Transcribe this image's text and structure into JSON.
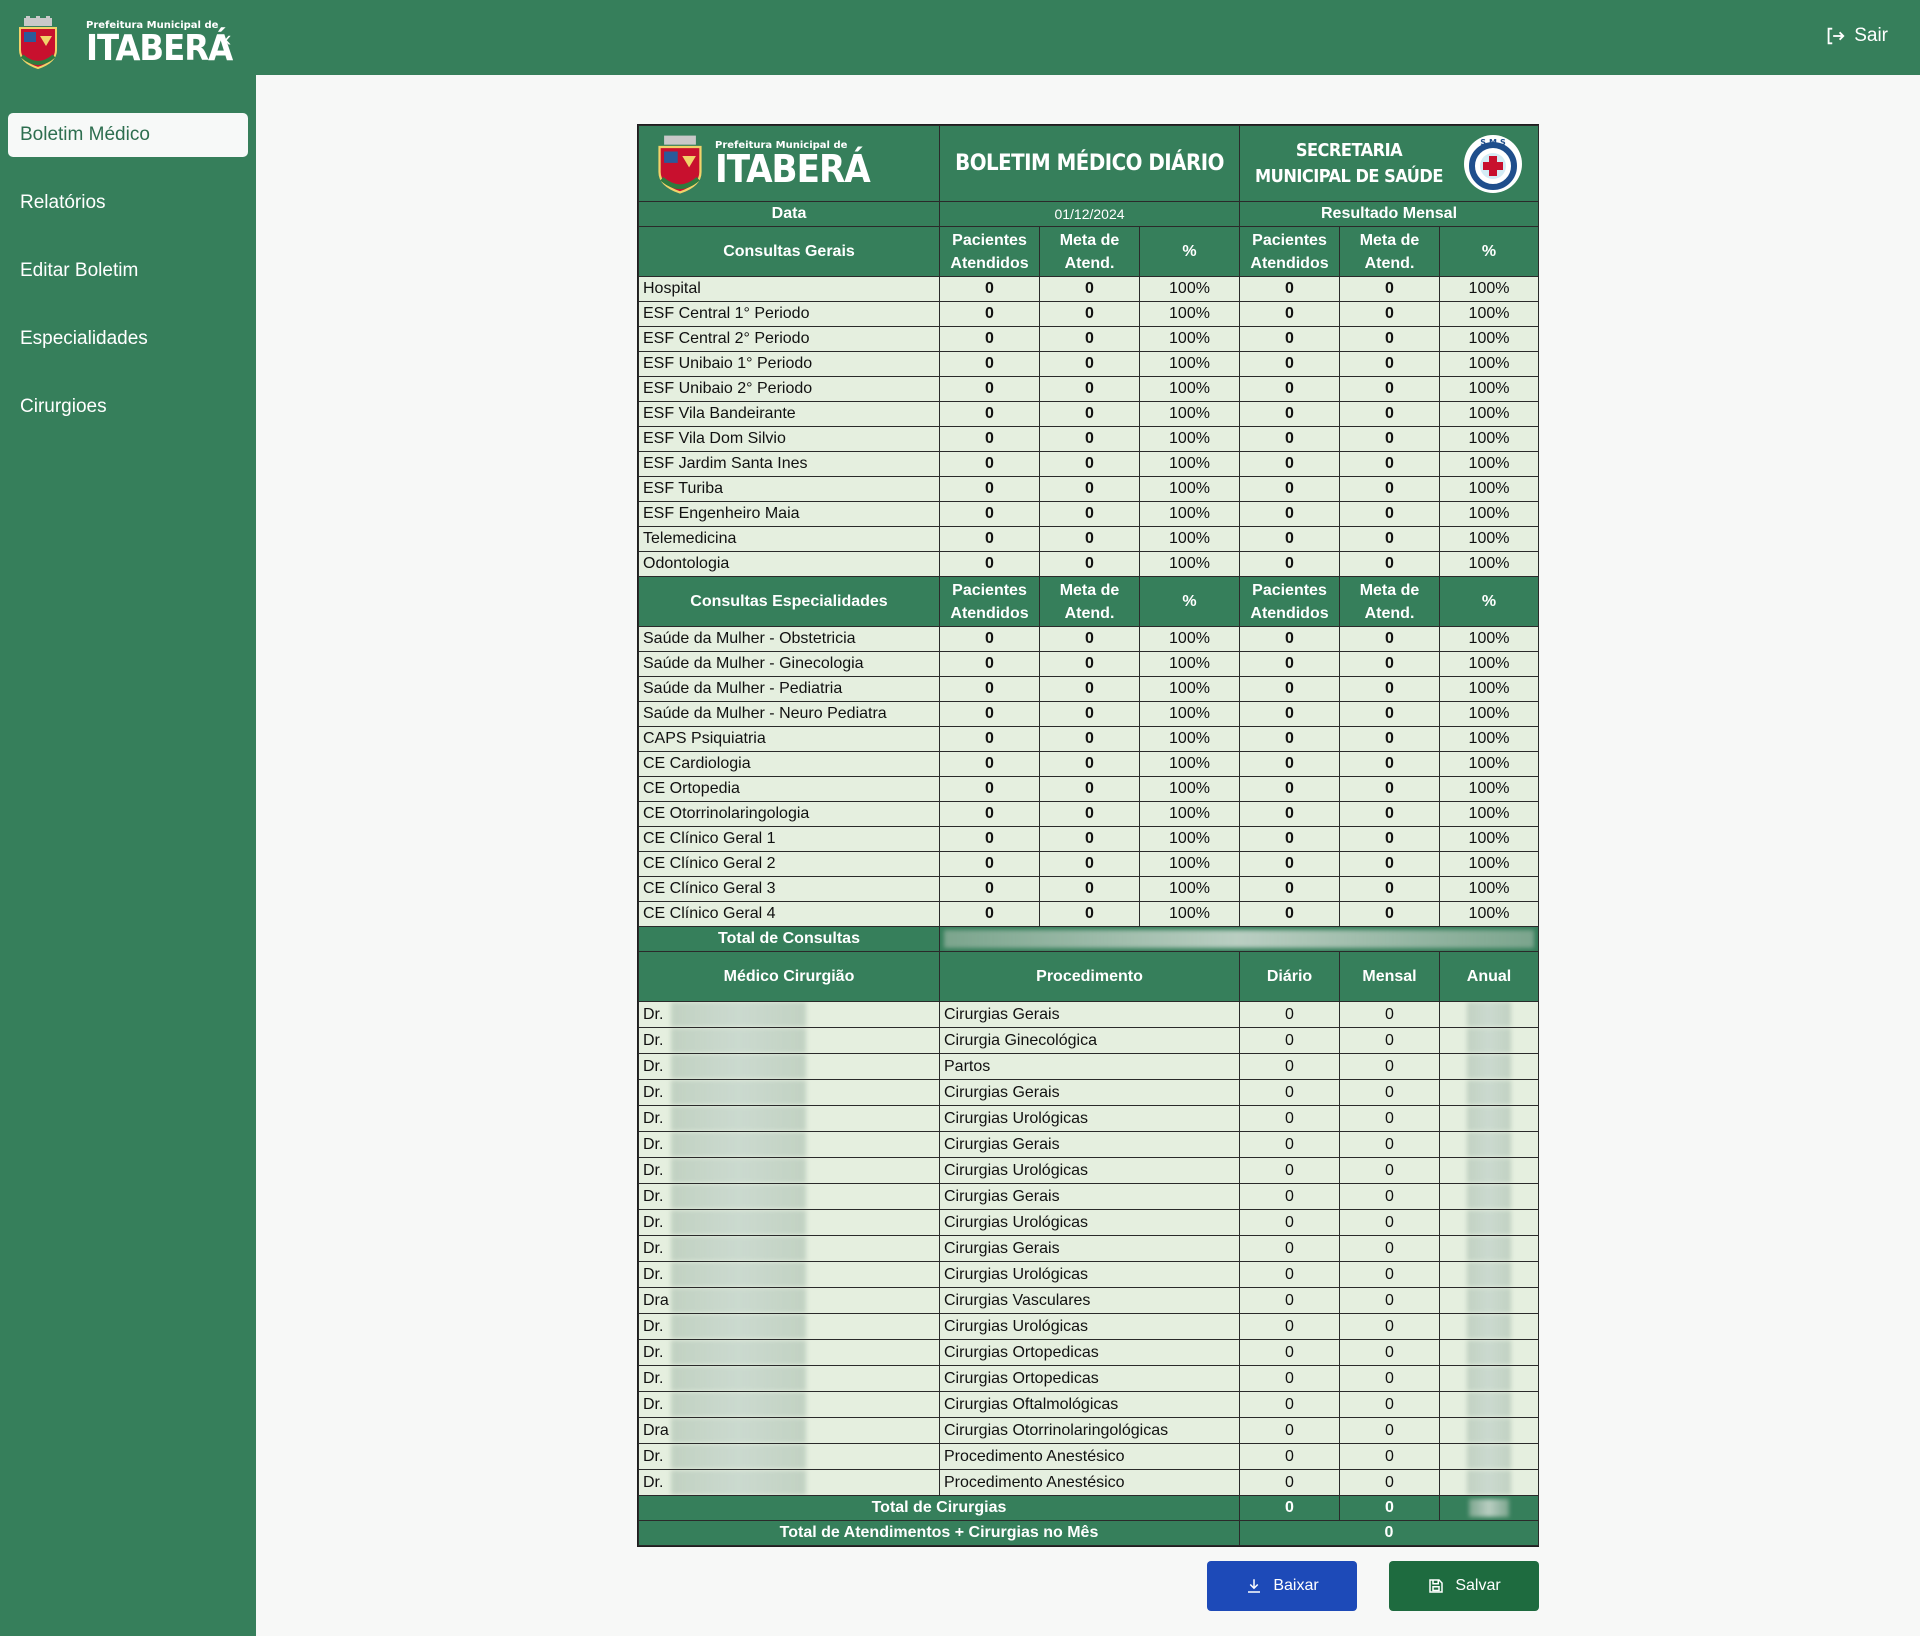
{
  "header": {
    "brand_prefix": "Prefeitura Municipal de",
    "brand_name": "ITABERÁ",
    "logout_label": "Sair"
  },
  "sidebar": {
    "items": [
      {
        "label": "Boletim Médico"
      },
      {
        "label": "Relatórios"
      },
      {
        "label": "Editar Boletim"
      },
      {
        "label": "Especialidades"
      },
      {
        "label": "Cirurgioes"
      }
    ]
  },
  "report": {
    "logo_prefix": "Prefeitura Municipal de",
    "logo_name": "ITABERÁ",
    "title": "BOLETIM MÉDICO DIÁRIO",
    "secretaria_line1": "SECRETARIA",
    "secretaria_line2": "MUNICIPAL DE SAÚDE",
    "sms_badge": "S.M.S",
    "data_label": "Data",
    "date": "01/12/2024",
    "monthly_label": "Resultado Mensal",
    "col_pacientes_1": "Pacientes",
    "col_pacientes_2": "Atendidos",
    "col_meta_1": "Meta de",
    "col_meta_2": "Atend.",
    "col_pct": "%",
    "general_label": "Consultas Gerais",
    "general_rows": [
      {
        "name": "Hospital",
        "pa": "0",
        "meta": "0",
        "pct": "100%",
        "mpa": "0",
        "mmeta": "0",
        "mpct": "100%"
      },
      {
        "name": "ESF Central 1° Periodo",
        "pa": "0",
        "meta": "0",
        "pct": "100%",
        "mpa": "0",
        "mmeta": "0",
        "mpct": "100%"
      },
      {
        "name": "ESF Central 2° Periodo",
        "pa": "0",
        "meta": "0",
        "pct": "100%",
        "mpa": "0",
        "mmeta": "0",
        "mpct": "100%"
      },
      {
        "name": "ESF Unibaio 1° Periodo",
        "pa": "0",
        "meta": "0",
        "pct": "100%",
        "mpa": "0",
        "mmeta": "0",
        "mpct": "100%"
      },
      {
        "name": "ESF Unibaio 2° Periodo",
        "pa": "0",
        "meta": "0",
        "pct": "100%",
        "mpa": "0",
        "mmeta": "0",
        "mpct": "100%"
      },
      {
        "name": "ESF Vila Bandeirante",
        "pa": "0",
        "meta": "0",
        "pct": "100%",
        "mpa": "0",
        "mmeta": "0",
        "mpct": "100%"
      },
      {
        "name": "ESF Vila Dom Silvio",
        "pa": "0",
        "meta": "0",
        "pct": "100%",
        "mpa": "0",
        "mmeta": "0",
        "mpct": "100%"
      },
      {
        "name": "ESF Jardim Santa Ines",
        "pa": "0",
        "meta": "0",
        "pct": "100%",
        "mpa": "0",
        "mmeta": "0",
        "mpct": "100%"
      },
      {
        "name": "ESF Turiba",
        "pa": "0",
        "meta": "0",
        "pct": "100%",
        "mpa": "0",
        "mmeta": "0",
        "mpct": "100%"
      },
      {
        "name": "ESF Engenheiro Maia",
        "pa": "0",
        "meta": "0",
        "pct": "100%",
        "mpa": "0",
        "mmeta": "0",
        "mpct": "100%"
      },
      {
        "name": "Telemedicina",
        "pa": "0",
        "meta": "0",
        "pct": "100%",
        "mpa": "0",
        "mmeta": "0",
        "mpct": "100%"
      },
      {
        "name": "Odontologia",
        "pa": "0",
        "meta": "0",
        "pct": "100%",
        "mpa": "0",
        "mmeta": "0",
        "mpct": "100%"
      }
    ],
    "special_label": "Consultas Especialidades",
    "special_rows": [
      {
        "name": "Saúde da Mulher - Obstetricia",
        "pa": "0",
        "meta": "0",
        "pct": "100%",
        "mpa": "0",
        "mmeta": "0",
        "mpct": "100%"
      },
      {
        "name": "Saúde da Mulher - Ginecologia",
        "pa": "0",
        "meta": "0",
        "pct": "100%",
        "mpa": "0",
        "mmeta": "0",
        "mpct": "100%"
      },
      {
        "name": "Saúde da Mulher - Pediatria",
        "pa": "0",
        "meta": "0",
        "pct": "100%",
        "mpa": "0",
        "mmeta": "0",
        "mpct": "100%"
      },
      {
        "name": "Saúde da Mulher - Neuro Pediatra",
        "pa": "0",
        "meta": "0",
        "pct": "100%",
        "mpa": "0",
        "mmeta": "0",
        "mpct": "100%"
      },
      {
        "name": "CAPS Psiquiatria",
        "pa": "0",
        "meta": "0",
        "pct": "100%",
        "mpa": "0",
        "mmeta": "0",
        "mpct": "100%"
      },
      {
        "name": "CE Cardiologia",
        "pa": "0",
        "meta": "0",
        "pct": "100%",
        "mpa": "0",
        "mmeta": "0",
        "mpct": "100%"
      },
      {
        "name": "CE Ortopedia",
        "pa": "0",
        "meta": "0",
        "pct": "100%",
        "mpa": "0",
        "mmeta": "0",
        "mpct": "100%"
      },
      {
        "name": "CE Otorrinolaringologia",
        "pa": "0",
        "meta": "0",
        "pct": "100%",
        "mpa": "0",
        "mmeta": "0",
        "mpct": "100%"
      },
      {
        "name": "CE Clínico Geral 1",
        "pa": "0",
        "meta": "0",
        "pct": "100%",
        "mpa": "0",
        "mmeta": "0",
        "mpct": "100%"
      },
      {
        "name": "CE Clínico Geral 2",
        "pa": "0",
        "meta": "0",
        "pct": "100%",
        "mpa": "0",
        "mmeta": "0",
        "mpct": "100%"
      },
      {
        "name": "CE Clínico Geral 3",
        "pa": "0",
        "meta": "0",
        "pct": "100%",
        "mpa": "0",
        "mmeta": "0",
        "mpct": "100%"
      },
      {
        "name": "CE Clínico Geral 4",
        "pa": "0",
        "meta": "0",
        "pct": "100%",
        "mpa": "0",
        "mmeta": "0",
        "mpct": "100%"
      }
    ],
    "total_consultas_label": "Total de Consultas",
    "surgery_headers": {
      "doctor": "Médico Cirurgião",
      "procedure": "Procedimento",
      "daily": "Diário",
      "monthly": "Mensal",
      "annual": "Anual"
    },
    "surgery_rows": [
      {
        "doctor": "Dr.",
        "procedure": "Cirurgias Gerais",
        "daily": "0",
        "monthly": "0"
      },
      {
        "doctor": "Dr.",
        "procedure": "Cirurgia Ginecológica",
        "daily": "0",
        "monthly": "0"
      },
      {
        "doctor": "Dr.",
        "procedure": "Partos",
        "daily": "0",
        "monthly": "0"
      },
      {
        "doctor": "Dr.",
        "procedure": "Cirurgias Gerais",
        "daily": "0",
        "monthly": "0"
      },
      {
        "doctor": "Dr.",
        "procedure": "Cirurgias Urológicas",
        "daily": "0",
        "monthly": "0"
      },
      {
        "doctor": "Dr.",
        "procedure": "Cirurgias Gerais",
        "daily": "0",
        "monthly": "0"
      },
      {
        "doctor": "Dr.",
        "procedure": "Cirurgias Urológicas",
        "daily": "0",
        "monthly": "0"
      },
      {
        "doctor": "Dr.",
        "procedure": "Cirurgias Gerais",
        "daily": "0",
        "monthly": "0"
      },
      {
        "doctor": "Dr.",
        "procedure": "Cirurgias Urológicas",
        "daily": "0",
        "monthly": "0"
      },
      {
        "doctor": "Dr.",
        "procedure": "Cirurgias Gerais",
        "daily": "0",
        "monthly": "0"
      },
      {
        "doctor": "Dr.",
        "procedure": "Cirurgias Urológicas",
        "daily": "0",
        "monthly": "0"
      },
      {
        "doctor": "Dra",
        "procedure": "Cirurgias Vasculares",
        "daily": "0",
        "monthly": "0"
      },
      {
        "doctor": "Dr.",
        "procedure": "Cirurgias Urológicas",
        "daily": "0",
        "monthly": "0"
      },
      {
        "doctor": "Dr.",
        "procedure": "Cirurgias Ortopedicas",
        "daily": "0",
        "monthly": "0"
      },
      {
        "doctor": "Dr.",
        "procedure": "Cirurgias Ortopedicas",
        "daily": "0",
        "monthly": "0"
      },
      {
        "doctor": "Dr.",
        "procedure": "Cirurgias Oftalmológicas",
        "daily": "0",
        "monthly": "0"
      },
      {
        "doctor": "Dra",
        "procedure": "Cirurgias Otorrinolaringológicas",
        "daily": "0",
        "monthly": "0"
      },
      {
        "doctor": "Dr.",
        "procedure": "Procedimento Anestésico",
        "daily": "0",
        "monthly": "0"
      },
      {
        "doctor": "Dr.",
        "procedure": "Procedimento Anestésico",
        "daily": "0",
        "monthly": "0"
      }
    ],
    "total_cirurgias_label": "Total de Cirurgias",
    "total_cirurgias_daily": "0",
    "total_cirurgias_monthly": "0",
    "grand_total_label": "Total de Atendimentos + Cirurgias no Mês",
    "grand_total_value": "0"
  },
  "actions": {
    "download_label": "Baixar",
    "save_label": "Salvar"
  },
  "colors": {
    "brand_green": "#367f5b",
    "row_bg": "#e5efdf",
    "download_blue": "#1d4ab8",
    "save_green": "#1e6b3f"
  }
}
